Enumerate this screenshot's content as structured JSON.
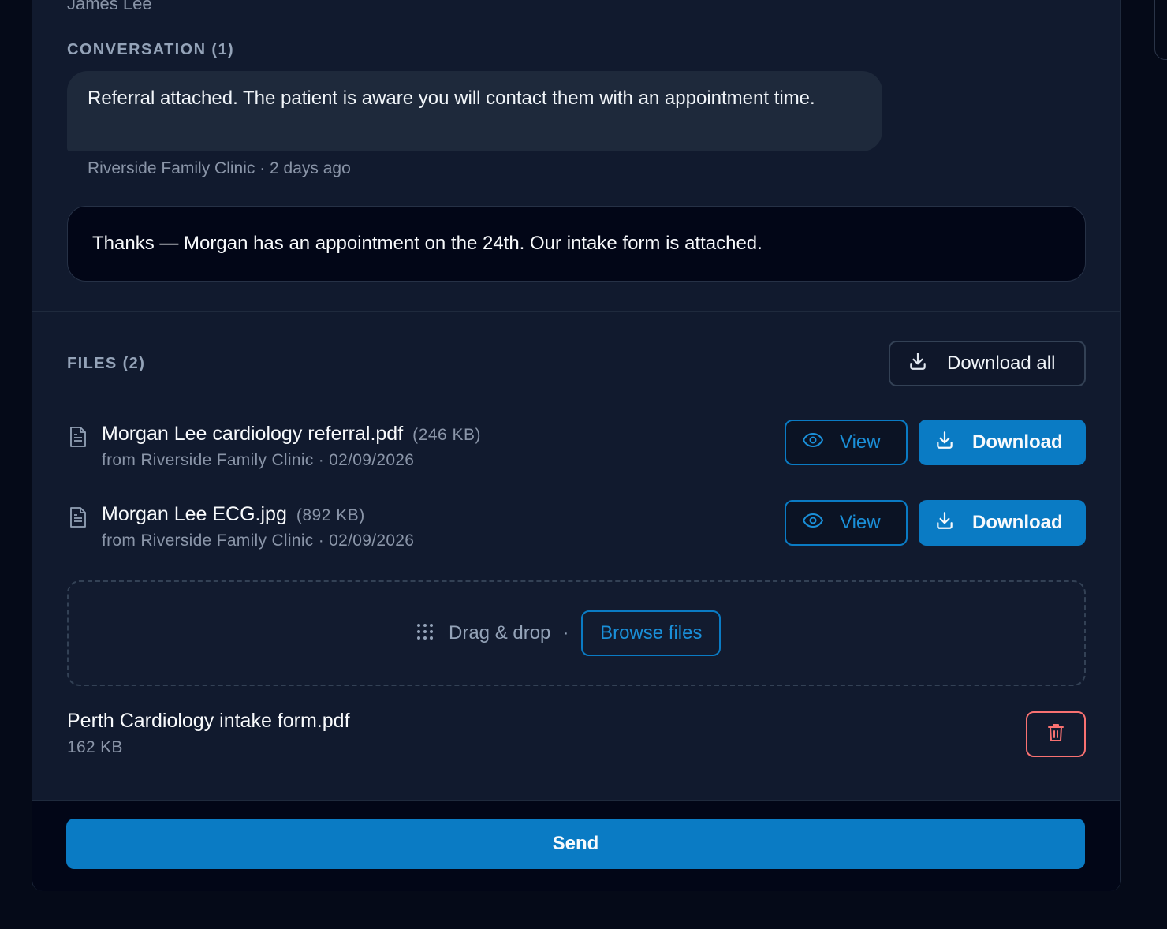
{
  "recipient_name": "James Lee",
  "conversation": {
    "title": "CONVERSATION (1)",
    "messages": [
      {
        "text": "Referral attached. The patient is aware you will contact them with an appointment time.",
        "meta": "Riverside Family Clinic · 2 days ago"
      }
    ]
  },
  "reply": {
    "value": "Thanks — Morgan has an appointment on the 24th. Our intake form is attached."
  },
  "files": {
    "title": "FILES (2)",
    "download_all_label": "Download all",
    "items": [
      {
        "name": "Morgan Lee cardiology referral.pdf",
        "size": "(246 KB)",
        "meta": "from Riverside Family Clinic · 02/09/2026",
        "view_label": "View",
        "download_label": "Download"
      },
      {
        "name": "Morgan Lee ECG.jpg",
        "size": "(892 KB)",
        "meta": "from Riverside Family Clinic · 02/09/2026",
        "view_label": "View",
        "download_label": "Download"
      }
    ]
  },
  "upload": {
    "drag_label": "Drag & drop",
    "separator": "·",
    "browse_label": "Browse files"
  },
  "attachment": {
    "name": "Perth Cardiology intake form.pdf",
    "size": "162 KB"
  },
  "footer": {
    "send_label": "Send"
  },
  "colors": {
    "accent": "#0a7bc4",
    "danger": "#f87171",
    "panel": "#111a2e"
  },
  "icons": {
    "file": "file-text-icon",
    "view": "eye-icon",
    "download": "download-icon",
    "drag": "grip-icon",
    "delete": "trash-icon"
  }
}
